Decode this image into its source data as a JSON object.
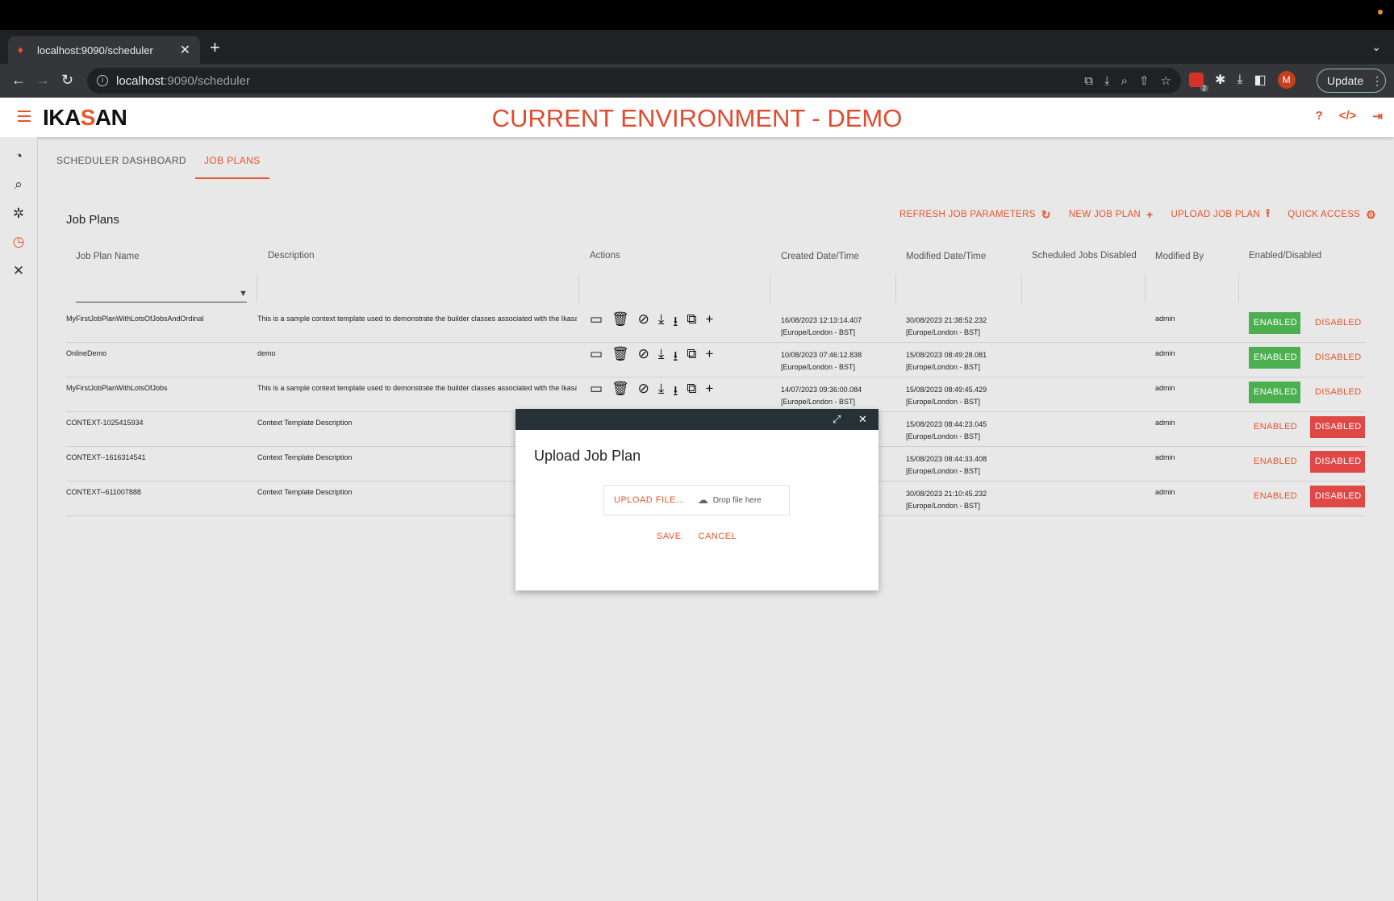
{
  "browser": {
    "tab_title": "localhost:9090/scheduler",
    "url_host": "localhost",
    "url_path": ":9090/scheduler",
    "extension_badge": "2",
    "avatar_letter": "M",
    "update_label": "Update"
  },
  "app": {
    "env_title": "CURRENT ENVIRONMENT - DEMO",
    "logo_prefix": "IKA",
    "logo_accent": "S",
    "logo_suffix": "AN"
  },
  "tabs": [
    {
      "label": "SCHEDULER DASHBOARD"
    },
    {
      "label": "JOB PLANS"
    }
  ],
  "section": {
    "title": "Job Plans",
    "actions": {
      "refresh": "REFRESH JOB PARAMETERS",
      "new": "NEW JOB PLAN",
      "upload": "UPLOAD JOB PLAN",
      "quick": "QUICK ACCESS"
    }
  },
  "table": {
    "headers": {
      "name": "Job Plan Name",
      "description": "Description",
      "actions": "Actions",
      "created": "Created Date/Time",
      "modified": "Modified Date/Time",
      "sched": "Scheduled Jobs Disabled",
      "modby": "Modified By",
      "enabled": "Enabled/Disabled"
    },
    "rows": [
      {
        "name": "MyFirstJobPlanWithLotsOfJobsAndOrdinal",
        "description": "This is a sample context template used to demonstrate the builder classes associated with the Ikasa",
        "created": "16/08/2023 12:13:14.407",
        "created_tz": "[Europe/London - BST]",
        "modified": "30/08/2023 21:38:52.232",
        "modified_tz": "[Europe/London - BST]",
        "modby": "admin",
        "enabled": "ENABLED",
        "disabled": "DISABLED",
        "state": "enabled"
      },
      {
        "name": "OnlineDemo",
        "description": "demo",
        "created": "10/08/2023 07:46:12.838",
        "created_tz": "[Europe/London - BST]",
        "modified": "15/08/2023 08:49:28.081",
        "modified_tz": "[Europe/London - BST]",
        "modby": "admin",
        "enabled": "ENABLED",
        "disabled": "DISABLED",
        "state": "enabled"
      },
      {
        "name": "MyFirstJobPlanWithLotsOfJobs",
        "description": "This is a sample context template used to demonstrate the builder classes associated with the Ikasa",
        "created": "14/07/2023 09:36:00.084",
        "created_tz": "[Europe/London - BST]",
        "modified": "15/08/2023 08:49:45.429",
        "modified_tz": "[Europe/London - BST]",
        "modby": "admin",
        "enabled": "ENABLED",
        "disabled": "DISABLED",
        "state": "enabled"
      },
      {
        "name": "CONTEXT-1025415934",
        "description": "Context Template Description",
        "created": "",
        "created_tz": "",
        "modified": "15/08/2023 08:44:23.045",
        "modified_tz": "[Europe/London - BST]",
        "modby": "admin",
        "enabled": "ENABLED",
        "disabled": "DISABLED",
        "state": "disabled"
      },
      {
        "name": "CONTEXT--1616314541",
        "description": "Context Template Description",
        "created": "",
        "created_tz": "",
        "modified": "15/08/2023 08:44:33.408",
        "modified_tz": "[Europe/London - BST]",
        "modby": "admin",
        "enabled": "ENABLED",
        "disabled": "DISABLED",
        "state": "disabled"
      },
      {
        "name": "CONTEXT--611007888",
        "description": "Context Template Description",
        "created": "",
        "created_tz": "",
        "modified": "30/08/2023 21:10:45.232",
        "modified_tz": "[Europe/London - BST]",
        "modby": "admin",
        "enabled": "ENABLED",
        "disabled": "DISABLED",
        "state": "disabled"
      }
    ]
  },
  "modal": {
    "title": "Upload Job Plan",
    "upload_label": "UPLOAD FILE...",
    "drop_label": "Drop file here",
    "save_label": "SAVE",
    "cancel_label": "CANCEL"
  },
  "colors": {
    "accent": "#e8542b",
    "enabled_green": "#4caf50",
    "disabled_red": "#e04848",
    "modal_header": "#263238"
  }
}
